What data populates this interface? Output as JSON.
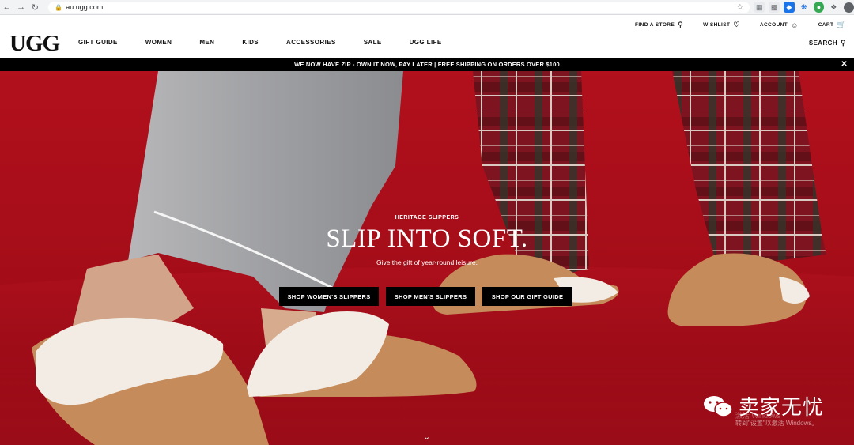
{
  "browser": {
    "url": "au.ugg.com"
  },
  "brand": {
    "logo": "UGG"
  },
  "header": {
    "main_nav": [
      "GIFT GUIDE",
      "WOMEN",
      "MEN",
      "KIDS",
      "ACCESSORIES",
      "SALE",
      "UGG LIFE"
    ],
    "util_nav": {
      "find_store": "FIND A STORE",
      "wishlist": "WISHLIST",
      "account": "ACCOUNT",
      "cart": "CART"
    },
    "search": "SEARCH"
  },
  "promo": {
    "text": "WE NOW HAVE ZIP - OWN IT NOW, PAY LATER | FREE SHIPPING ON ORDERS OVER $100"
  },
  "hero": {
    "eyebrow": "HERITAGE SLIPPERS",
    "headline": "SLIP INTO SOFT.",
    "subline": "Give the gift of year-round leisure.",
    "ctas": [
      "SHOP WOMEN'S SLIPPERS",
      "SHOP MEN'S SLIPPERS",
      "SHOP OUR GIFT GUIDE"
    ]
  },
  "overlay": {
    "watermark": "卖家无忧",
    "windows_line1": "激活 Windows",
    "windows_line2": "转到\"设置\"以激活 Windows。"
  },
  "colors": {
    "hero_red": "#a40d18",
    "banner_black": "#000000",
    "slipper_tan": "#c58b5b",
    "fleece": "#f3ece4"
  },
  "icons": [
    "back-icon",
    "forward-icon",
    "reload-icon",
    "lock-icon",
    "star-icon",
    "location-pin-icon",
    "heart-icon",
    "user-icon",
    "cart-icon",
    "search-icon",
    "close-icon",
    "chevron-down-icon"
  ]
}
